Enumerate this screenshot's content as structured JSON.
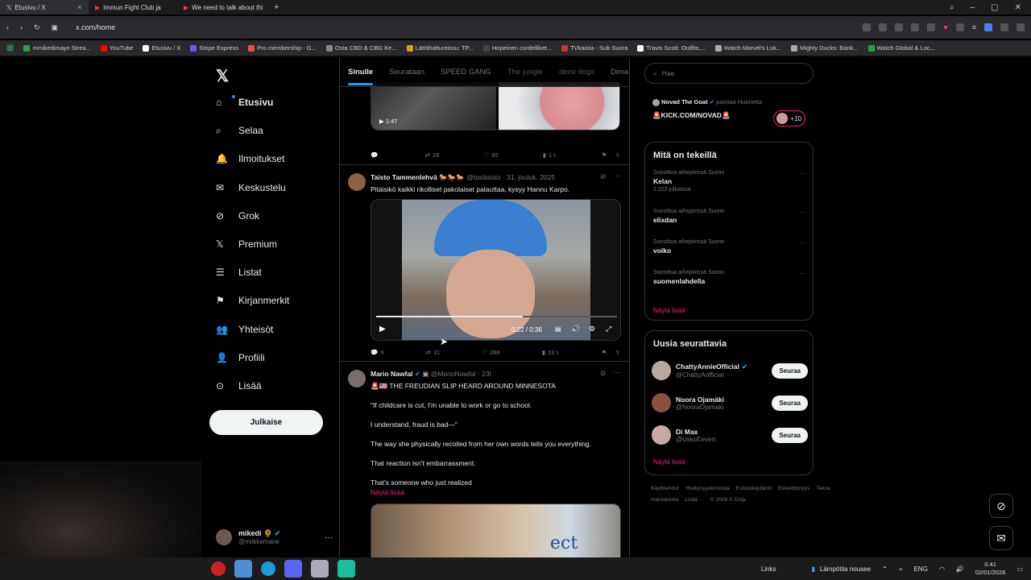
{
  "browser": {
    "tabs": [
      {
        "label": "Etusivu / X",
        "active": true
      },
      {
        "label": "Immun Fight Club ja",
        "active": false
      },
      {
        "label": "We need to talk about thi",
        "active": false
      }
    ],
    "url": "x.com/home",
    "bookmarks": [
      {
        "label": "mmikedimayn Strea...",
        "color": "#2ea043"
      },
      {
        "label": "YouTube",
        "color": "#ff0000"
      },
      {
        "label": "Etusivu / X",
        "color": "#ffffff"
      },
      {
        "label": "Stripe Express",
        "color": "#635bff"
      },
      {
        "label": "Pro membership - G...",
        "color": "#e5534b"
      },
      {
        "label": "Osta CBD & CBG Ke...",
        "color": "#888888"
      },
      {
        "label": "Lättähattureissu: TP...",
        "color": "#d4a017"
      },
      {
        "label": "Hopeinen cordelliket...",
        "color": "#444444"
      },
      {
        "label": "TVkaista - Sub Suora",
        "color": "#c0392b"
      },
      {
        "label": "Travis Scott: Outfits,...",
        "color": "#ffffff"
      },
      {
        "label": "Watch Marvel's Luk...",
        "color": "#aaaaaa"
      },
      {
        "label": "Mighty Ducks: Bank...",
        "color": "#aaaaaa"
      },
      {
        "label": "Watch Global & Loc...",
        "color": "#2ea043"
      }
    ]
  },
  "nav": {
    "items": [
      {
        "label": "Etusivu",
        "icon": "home-icon"
      },
      {
        "label": "Selaa",
        "icon": "search-icon"
      },
      {
        "label": "Ilmoitukset",
        "icon": "bell-icon"
      },
      {
        "label": "Keskustelu",
        "icon": "mail-icon"
      },
      {
        "label": "Grok",
        "icon": "grok-icon"
      },
      {
        "label": "Premium",
        "icon": "x-icon"
      },
      {
        "label": "Listat",
        "icon": "list-icon"
      },
      {
        "label": "Kirjanmerkit",
        "icon": "bookmark-icon"
      },
      {
        "label": "Yhteisöt",
        "icon": "community-icon"
      },
      {
        "label": "Profiili",
        "icon": "person-icon"
      },
      {
        "label": "Lisää",
        "icon": "more-circle-icon"
      }
    ],
    "post_button": "Julkaise",
    "account": {
      "name": "mikedi",
      "handle": "@miikkemane"
    }
  },
  "feed": {
    "tabs": [
      "Sinulle",
      "Seurataan",
      "SPEED GANG",
      "The jungle",
      "demi dogs",
      "Dima's Di"
    ],
    "post0": {
      "duration": "1:47",
      "replies": "",
      "reposts": "28",
      "likes": "95",
      "views": "1 t."
    },
    "post1": {
      "name": "Taisto Tammenlehvä",
      "emoji": "🐎🐎🐎",
      "handle": "@tositaisto",
      "date": "· 31. jouluk. 2025",
      "text": "Pitäisikö kaikki rikolliset pakolaiset palauttaa, kysyy Hannu Karpo.",
      "video_time": "0:22 / 0:36",
      "video_progress": 0.61,
      "replies": "9",
      "reposts": "31",
      "likes": "288",
      "views": "13 t."
    },
    "post2": {
      "name": "Mario Nawfal",
      "handle": "@MarioNawfal",
      "date": "· 23t",
      "lines": [
        "🚨🇺🇸 THE FREUDIAN SLIP HEARD AROUND MINNESOTA",
        "\"If childcare is cut, I'm unable to work or go to school.",
        "I understand, fraud is bad—\"",
        "The way she physically recoiled from her own words tells you everything.",
        "That reaction isn't embarrassment.",
        "That's someone who just realized"
      ],
      "show_more": "Näytä lisää",
      "image_text": "ect"
    }
  },
  "sidebar": {
    "search_placeholder": "Hae",
    "live": {
      "name": "Novad The Goat",
      "action": "juontaa Huonetta",
      "title": "🚨KICK.COM/NOVAD🚨",
      "count": "+10"
    },
    "trends_title": "Mitä on tekeillä",
    "trends": [
      {
        "context": "Suosittua aihepiirissä Suomi",
        "topic": "Kelan",
        "count": "1 223 julkaisua"
      },
      {
        "context": "Suosittua aihepiirissä Suomi",
        "topic": "elixdan",
        "count": ""
      },
      {
        "context": "Suosittua aihepiirissä Suomi",
        "topic": "voiko",
        "count": ""
      },
      {
        "context": "Suosittua aihepiirissä Suomi",
        "topic": "suomenlahdella",
        "count": ""
      }
    ],
    "trends_more": "Näytä lisää",
    "who_title": "Uusia seurattavia",
    "who": [
      {
        "name": "ChattyAnnieOfficial",
        "handle": "@ChattyAofficial",
        "button": "Seuraa",
        "verified": true
      },
      {
        "name": "Noora Ojamäki",
        "handle": "@NooraOjamaki",
        "button": "Seuraa",
        "verified": false
      },
      {
        "name": "Di Max",
        "handle": "@UskoEevert",
        "button": "Seuraa",
        "verified": false
      }
    ],
    "who_more": "Näytä lisää",
    "footer": [
      "Käyttöehdot",
      "Yksityisyydensuoja",
      "Evästekäytäntö",
      "Esteettömyys",
      "Tietoa mainoksista",
      "Lisää ···",
      "© 2026 X Corp."
    ]
  },
  "taskbar": {
    "links": "Links",
    "weather": "Lämpötila nousee",
    "lang": "ENG",
    "time": "0.41",
    "date": "02/01/2026"
  },
  "colors": {
    "accent": "#1d9bf0",
    "pink": "#f91880",
    "bg": "#000000",
    "border": "#2f3336"
  }
}
